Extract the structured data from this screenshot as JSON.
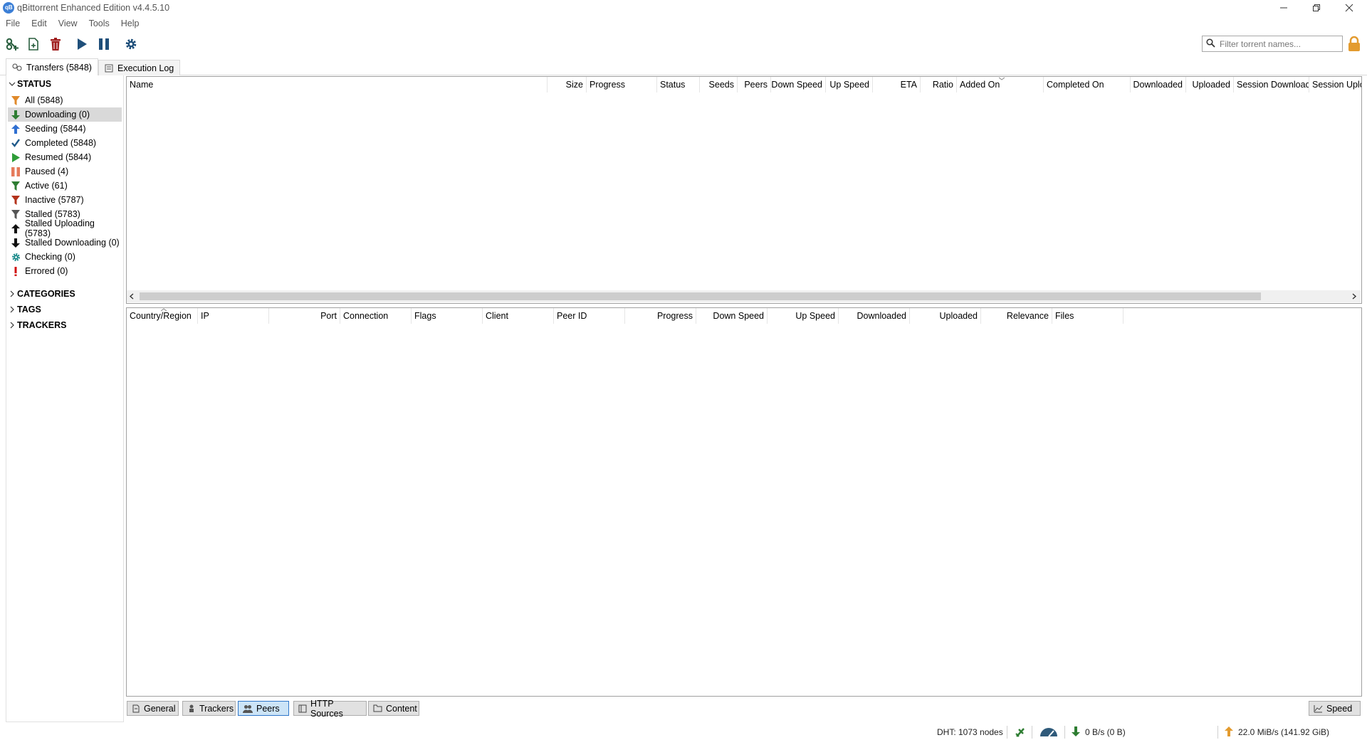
{
  "window": {
    "title": "qBittorrent Enhanced Edition v4.4.5.10"
  },
  "menu": [
    "File",
    "Edit",
    "View",
    "Tools",
    "Help"
  ],
  "toolbar": {
    "icons": [
      "add-link-icon",
      "add-file-icon",
      "delete-icon",
      "resume-icon",
      "pause-icon",
      "options-gear-icon"
    ],
    "filter_placeholder": "Filter torrent names..."
  },
  "tabs": [
    {
      "label": "Transfers (5848)",
      "icon": "transfers-icon",
      "active": true
    },
    {
      "label": "Execution Log",
      "icon": "log-icon",
      "active": false
    }
  ],
  "sidebar": {
    "status_header": "STATUS",
    "status_items": [
      {
        "label": "All (5848)",
        "icon": "filter-icon",
        "color": "#e0892a"
      },
      {
        "label": "Downloading (0)",
        "icon": "down-arrow-icon",
        "color": "#2e7d32",
        "selected": true
      },
      {
        "label": "Seeding (5844)",
        "icon": "up-arrow-icon",
        "color": "#2f6fd1"
      },
      {
        "label": "Completed (5848)",
        "icon": "checkmark-icon",
        "color": "#1f5a8a"
      },
      {
        "label": "Resumed (5844)",
        "icon": "play-icon",
        "color": "#2e9d38"
      },
      {
        "label": "Paused (4)",
        "icon": "pause-icon",
        "color": "#e57a5a"
      },
      {
        "label": "Active (61)",
        "icon": "filter-icon",
        "color": "#2e7d32"
      },
      {
        "label": "Inactive (5787)",
        "icon": "filter-icon",
        "color": "#b3321b"
      },
      {
        "label": "Stalled (5783)",
        "icon": "filter-icon",
        "color": "#555555"
      },
      {
        "label": "Stalled Uploading (5783)",
        "icon": "up-arrow-icon",
        "color": "#111111"
      },
      {
        "label": "Stalled Downloading (0)",
        "icon": "down-arrow-icon",
        "color": "#111111"
      },
      {
        "label": "Checking (0)",
        "icon": "gear-icon",
        "color": "#1a8a8a"
      },
      {
        "label": "Errored (0)",
        "icon": "exclamation-icon",
        "color": "#d01010"
      }
    ],
    "categories_header": "CATEGORIES",
    "tags_header": "TAGS",
    "trackers_header": "TRACKERS"
  },
  "torrent_table": {
    "columns": [
      "Name",
      "Size",
      "Progress",
      "Status",
      "Seeds",
      "Peers",
      "Down Speed",
      "Up Speed",
      "ETA",
      "Ratio",
      "Added On",
      "Completed On",
      "Downloaded",
      "Uploaded",
      "Session Download",
      "Session Uplo"
    ]
  },
  "peers_table": {
    "columns": [
      "Country/Region",
      "IP",
      "Port",
      "Connection",
      "Flags",
      "Client",
      "Peer ID",
      "Progress",
      "Down Speed",
      "Up Speed",
      "Downloaded",
      "Uploaded",
      "Relevance",
      "Files"
    ]
  },
  "bottom_tabs": [
    {
      "label": "General",
      "icon": "general-icon"
    },
    {
      "label": "Trackers",
      "icon": "trackers-icon"
    },
    {
      "label": "Peers",
      "icon": "peers-icon",
      "active": true
    },
    {
      "label": "HTTP Sources",
      "icon": "http-sources-icon"
    },
    {
      "label": "Content",
      "icon": "content-folder-icon"
    }
  ],
  "speed_button": "Speed",
  "status_bar": {
    "dht": "DHT: 1073 nodes",
    "download": "0 B/s (0 B)",
    "upload": "22.0 MiB/s (141.92 GiB)"
  }
}
